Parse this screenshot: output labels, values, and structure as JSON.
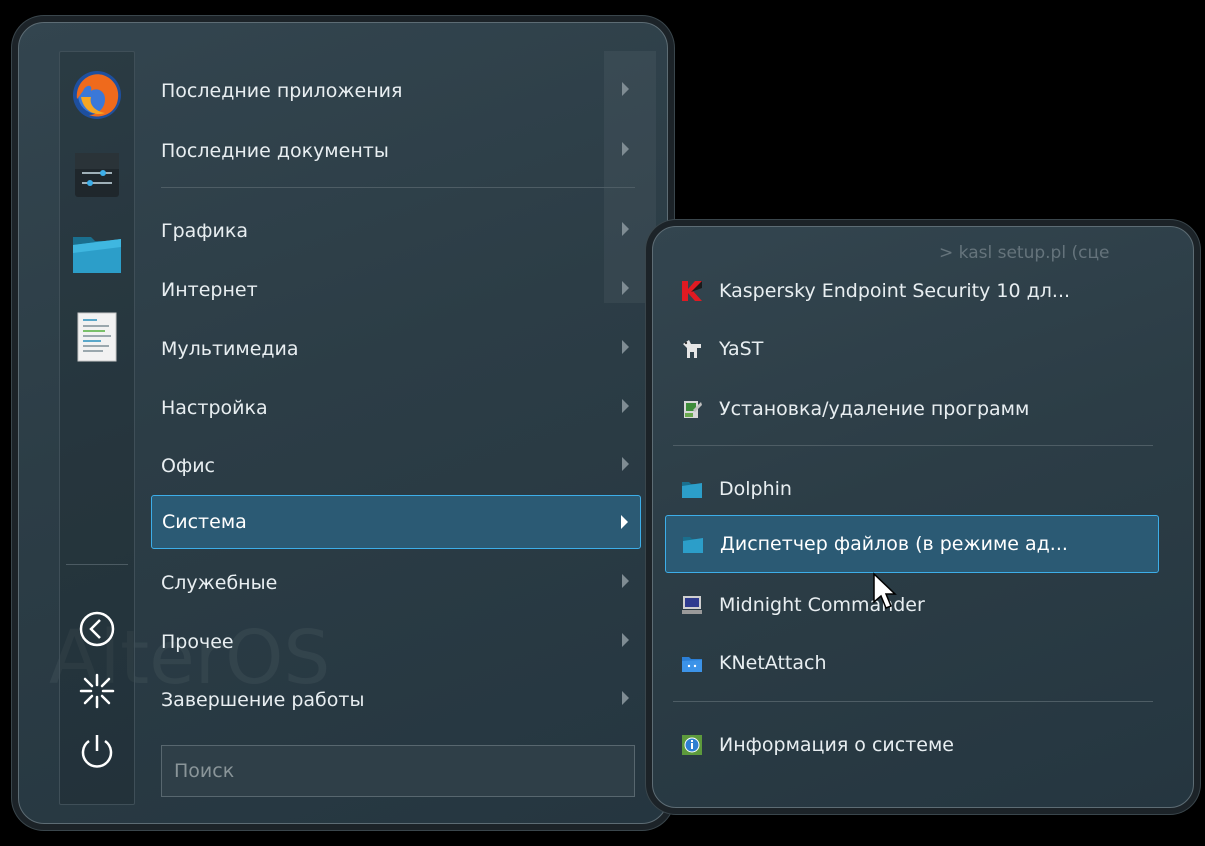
{
  "main_menu": {
    "categories": [
      {
        "label": "Последние приложения"
      },
      {
        "label": "Последние документы"
      },
      {
        "label": "Графика"
      },
      {
        "label": "Интернет"
      },
      {
        "label": "Мультимедиа"
      },
      {
        "label": "Настройка"
      },
      {
        "label": "Офис"
      },
      {
        "label": "Система",
        "selected": true
      },
      {
        "label": "Служебные"
      },
      {
        "label": "Прочее"
      },
      {
        "label": "Завершение работы"
      }
    ],
    "search": {
      "placeholder": "Поиск"
    },
    "watermark": "AlterOS",
    "favorites": [
      {
        "icon": "firefox-icon"
      },
      {
        "icon": "system-settings-icon"
      },
      {
        "icon": "folder-icon"
      },
      {
        "icon": "text-document-icon"
      }
    ],
    "session_buttons": [
      {
        "icon": "back-circle-icon"
      },
      {
        "icon": "lock-burst-icon"
      },
      {
        "icon": "power-icon"
      }
    ]
  },
  "submenu": {
    "background_text": "> kasl setup.pl (сце",
    "items": [
      {
        "label": "Kaspersky Endpoint Security 10 дл...",
        "icon": "kaspersky-icon"
      },
      {
        "label": "YaST",
        "icon": "yast-icon"
      },
      {
        "label": "Установка/удаление программ",
        "icon": "software-install-icon"
      },
      {
        "label": "Dolphin",
        "icon": "dolphin-folder-icon"
      },
      {
        "label": "Диспетчер файлов (в режиме ад...",
        "icon": "dolphin-folder-icon",
        "selected": true
      },
      {
        "label": "Midnight Commander",
        "icon": "terminal-monitor-icon"
      },
      {
        "label": "KNetAttach",
        "icon": "network-folder-icon"
      },
      {
        "label": "Информация о системе",
        "icon": "info-icon"
      }
    ]
  },
  "colors": {
    "accent": "#3daee9",
    "panel": "#2c3d46",
    "text": "#e8eef1"
  }
}
